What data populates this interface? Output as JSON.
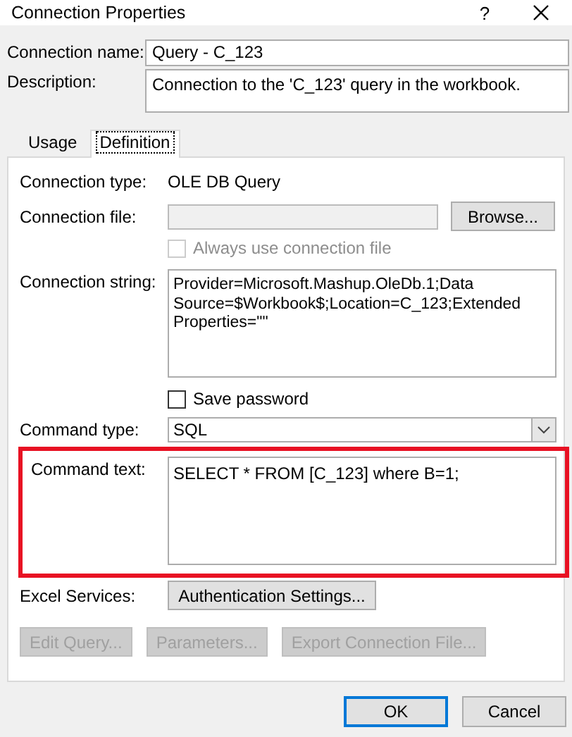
{
  "window": {
    "title": "Connection Properties",
    "help": "?"
  },
  "connection_name": {
    "label": "Connection name:",
    "value": "Query - C_123"
  },
  "description": {
    "label": "Description:",
    "value": "Connection to the 'C_123' query in the workbook."
  },
  "tabs": [
    {
      "label": "Usage",
      "selected": false
    },
    {
      "label": "Definition",
      "selected": true
    }
  ],
  "connection_type": {
    "label": "Connection type:",
    "value": "OLE DB Query"
  },
  "connection_file": {
    "label": "Connection file:",
    "disabled": true,
    "button": "Browse..."
  },
  "always_use": {
    "label": "Always use connection file",
    "checked": false,
    "disabled": true
  },
  "connection_string": {
    "label": "Connection string:",
    "value": "Provider=Microsoft.Mashup.OleDb.1;Data Source=$Workbook$;Location=C_123;Extended Properties=\"\""
  },
  "save_password": {
    "label": "Save password",
    "checked": false,
    "disabled": false
  },
  "command_type": {
    "label": "Command type:",
    "value": "SQL"
  },
  "command_text": {
    "label": "Command text:",
    "value": "SELECT * FROM [C_123] where B=1;",
    "highlighted": true
  },
  "excel_services": {
    "label": "Excel Services:",
    "button": "Authentication Settings...",
    "disabled": false
  },
  "action_buttons": [
    {
      "label": "Edit Query...",
      "disabled": true
    },
    {
      "label": "Parameters...",
      "disabled": true
    },
    {
      "label": "Export Connection File...",
      "disabled": true
    }
  ],
  "footer_buttons": [
    {
      "label": "OK",
      "default": true
    },
    {
      "label": "Cancel",
      "default": false
    }
  ]
}
